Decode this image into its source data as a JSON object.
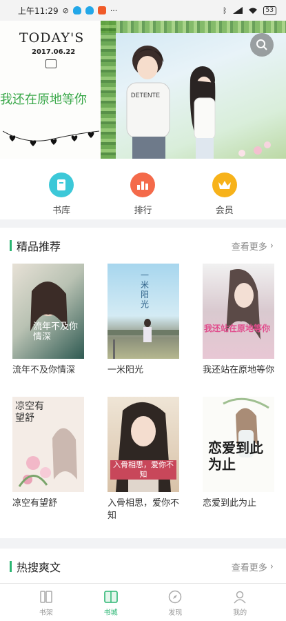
{
  "status_bar": {
    "time": "上午11:29",
    "battery": "53"
  },
  "banner": {
    "today": "TODAY'S",
    "date": "2017.06.22",
    "caption": "我还在原地等你",
    "tshirt_text": "DETENTE"
  },
  "quick_nav": [
    {
      "label": "书库",
      "icon": "book-store-icon",
      "color": "#3cc8d8"
    },
    {
      "label": "排行",
      "icon": "ranking-icon",
      "color": "#f46a4a"
    },
    {
      "label": "会员",
      "icon": "vip-crown-icon",
      "color": "#f7b21a"
    }
  ],
  "recommend": {
    "title": "精品推荐",
    "more": "查看更多",
    "books": [
      {
        "name": "流年不及你情深",
        "cover_text": "流年不及你情深",
        "cover_color": "#2f5a52"
      },
      {
        "name": "一米阳光",
        "cover_text": "一米阳光",
        "cover_color": "#9fd2ea"
      },
      {
        "name": "我还站在原地等你",
        "cover_text": "我还站在原地等你",
        "cover_color": "#e8c7d4"
      },
      {
        "name": "凉空有望舒",
        "cover_text": "凉空有望舒",
        "cover_color": "#f4ece6"
      },
      {
        "name": "入骨相思，爱你不知",
        "cover_text": "入骨相思，爱你不知",
        "cover_color": "#c7a789"
      },
      {
        "name": "恋爱到此为止",
        "cover_text": "恋爱到此为止",
        "cover_color": "#e9eee6"
      }
    ]
  },
  "hot": {
    "title": "热搜爽文",
    "more": "查看更多"
  },
  "tabs": [
    {
      "label": "书架",
      "icon": "bookshelf-icon",
      "active": false
    },
    {
      "label": "书城",
      "icon": "bookstore-icon",
      "active": true
    },
    {
      "label": "发现",
      "icon": "compass-icon",
      "active": false
    },
    {
      "label": "我的",
      "icon": "profile-icon",
      "active": false
    }
  ],
  "colors": {
    "accent": "#2bb673"
  }
}
